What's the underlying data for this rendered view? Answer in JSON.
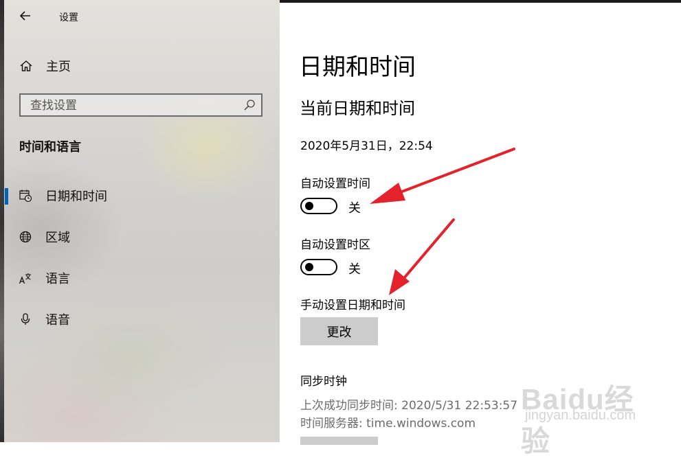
{
  "window": {
    "title": "设置"
  },
  "sidebar": {
    "home_label": "主页",
    "search_placeholder": "查找设置",
    "section_title": "时间和语言",
    "items": [
      {
        "label": "日期和时间",
        "icon": "calendar-clock-icon",
        "selected": true
      },
      {
        "label": "区域",
        "icon": "globe-icon",
        "selected": false
      },
      {
        "label": "语言",
        "icon": "language-icon",
        "selected": false
      },
      {
        "label": "语音",
        "icon": "microphone-icon",
        "selected": false
      }
    ]
  },
  "main": {
    "title": "日期和时间",
    "subtitle": "当前日期和时间",
    "current_datetime": "2020年5月31日，22:54",
    "auto_time": {
      "label": "自动设置时间",
      "state": "关"
    },
    "auto_timezone": {
      "label": "自动设置时区",
      "state": "关"
    },
    "manual": {
      "label": "手动设置日期和时间",
      "button": "更改"
    },
    "sync": {
      "title": "同步时钟",
      "last_sync": "上次成功同步时间: 2020/5/31 22:53:57",
      "server": "时间服务器: time.windows.com"
    }
  },
  "watermark": {
    "brand": "Baidu经验",
    "site": "jingyan.baidu.com"
  },
  "colors": {
    "accent": "#0063b1",
    "annotation": "#e3222b",
    "button": "#cccccc"
  }
}
